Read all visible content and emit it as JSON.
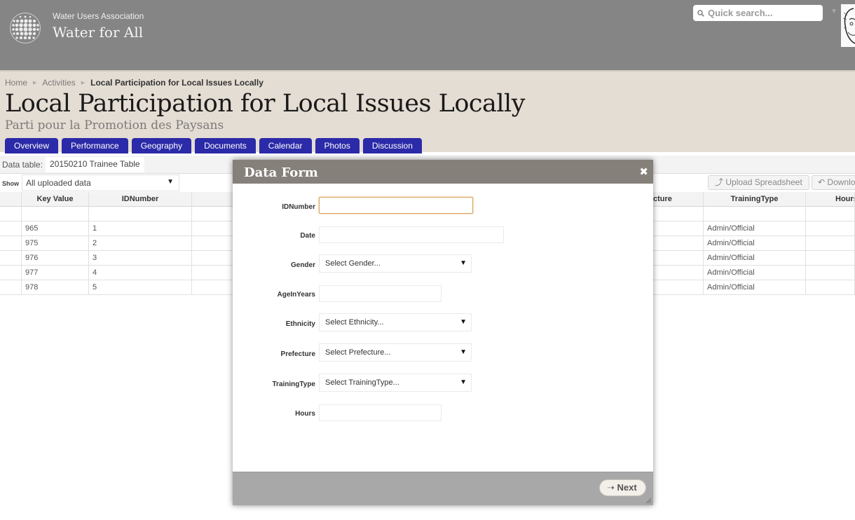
{
  "header": {
    "org_name": "Water Users Association",
    "site_name": "Water for All",
    "search_placeholder": "Quick search..."
  },
  "breadcrumb": {
    "items": [
      "Home",
      "Activities",
      "Local Participation for Local Issues Locally"
    ]
  },
  "page": {
    "title": "Local Participation for Local Issues Locally",
    "subtitle": "Parti pour la Promotion des Paysans"
  },
  "tabs": [
    "Overview",
    "Performance",
    "Geography",
    "Documents",
    "Calendar",
    "Photos",
    "Discussion"
  ],
  "data_table": {
    "label": "Data table:",
    "name": "20150210 Trainee Table",
    "show_label": "Show",
    "show_value": "All uploaded data",
    "upload_label": "Upload Spreadsheet",
    "download_label": "Downlo"
  },
  "grid": {
    "headers": [
      "Key Value",
      "IDNumber",
      "",
      "cture",
      "TrainingType",
      "Hours"
    ],
    "rows": [
      {
        "key": "965",
        "id": "1",
        "training": "Admin/Official"
      },
      {
        "key": "975",
        "id": "2",
        "training": "Admin/Official"
      },
      {
        "key": "976",
        "id": "3",
        "training": "Admin/Official"
      },
      {
        "key": "977",
        "id": "4",
        "training": "Admin/Official"
      },
      {
        "key": "978",
        "id": "5",
        "training": "Admin/Official"
      }
    ]
  },
  "modal": {
    "title": "Data Form",
    "fields": {
      "idnumber": {
        "label": "IDNumber",
        "value": ""
      },
      "date": {
        "label": "Date",
        "value": ""
      },
      "gender": {
        "label": "Gender",
        "value": "Select Gender..."
      },
      "age": {
        "label": "AgeInYears",
        "value": ""
      },
      "ethnicity": {
        "label": "Ethnicity",
        "value": "Select Ethnicity..."
      },
      "prefecture": {
        "label": "Prefecture",
        "value": "Select Prefecture..."
      },
      "training": {
        "label": "TrainingType",
        "value": "Select TrainingType..."
      },
      "hours": {
        "label": "Hours",
        "value": ""
      }
    },
    "next_label": "Next"
  },
  "colors": {
    "header_bg": "#858585",
    "band_bg": "#e4ddd3",
    "tab_bg": "#2b2aa8",
    "modal_head_bg": "#858079",
    "focus_border": "#d9a35a"
  }
}
